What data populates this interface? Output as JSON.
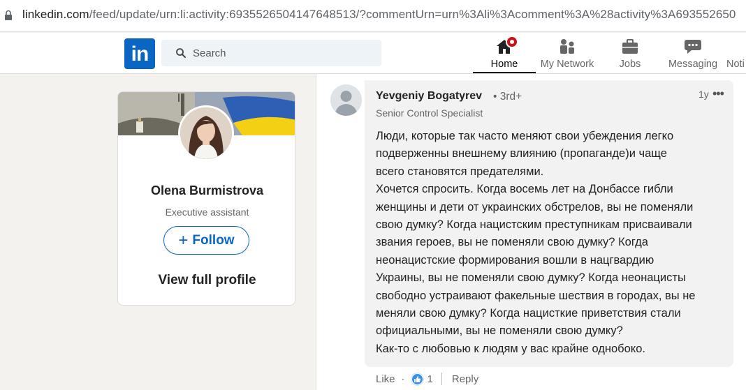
{
  "browser": {
    "url_host": "linkedin.com",
    "url_rest": "/feed/update/urn:li:activity:6935526504147648513/?commentUrn=urn%3Ali%3Acomment%3A%28activity%3A693552650"
  },
  "nav": {
    "logo_text": "in",
    "search_placeholder": "Search",
    "items": [
      {
        "label": "Home",
        "icon": "home-icon",
        "active": true
      },
      {
        "label": "My Network",
        "icon": "network-icon"
      },
      {
        "label": "Jobs",
        "icon": "briefcase-icon"
      },
      {
        "label": "Messaging",
        "icon": "messaging-icon"
      },
      {
        "label": "Noti",
        "icon": "bell-icon"
      }
    ]
  },
  "profile": {
    "name": "Olena Burmistrova",
    "title": "Executive assistant",
    "follow_label": "Follow",
    "view_profile_label": "View full profile"
  },
  "comment": {
    "author": "Yevgeniy Bogatyrev",
    "degree": "• 3rd+",
    "headline": "Senior Control Specialist",
    "time": "1y",
    "more": "•••",
    "lines": [
      "Люди, которые так часто меняют свои убеждения легко",
      "подверженны внешнему влиянию (пропаганде)и чаще",
      "всего становятся предателями.",
      "Хочется спросить. Когда восемь лет на Донбассе гибли",
      "женщины и дети от украинских обстрелов, вы не поменяли",
      "свою думку? Когда нацистским преступникам присваивали",
      "звания героев, вы не поменяли свою думку? Когда",
      "неонацистские формирования вошли в нацгвардию",
      "Украины, вы не поменяли свою думку? Когда неонацисты",
      "свободно устраивают факельные шествия в городах, вы не",
      "меняли свою думку? Когда нацисткие приветствия стали",
      "официальными, вы не поменяли свою думку?",
      "Как-то с любовью к людям у вас крайне однобоко."
    ],
    "like_label": "Like",
    "dot": "·",
    "reaction_count": "1",
    "reply_label": "Reply"
  }
}
